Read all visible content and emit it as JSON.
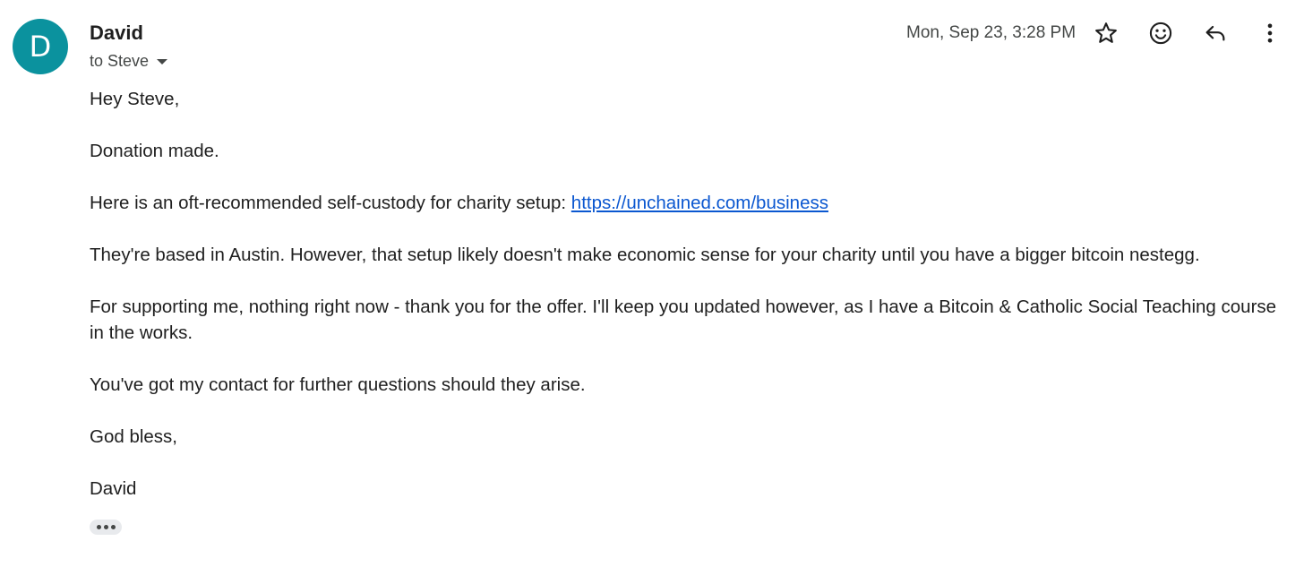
{
  "sender": {
    "avatar_letter": "D",
    "avatar_color": "#0b929e",
    "name": "David",
    "recipient_label": "to Steve"
  },
  "meta": {
    "timestamp": "Mon, Sep 23, 3:28 PM"
  },
  "toolbar": {
    "icons": [
      "star-icon",
      "emoji-icon",
      "reply-icon",
      "more-vert-icon"
    ]
  },
  "message": {
    "greeting": "Hey Steve,",
    "p1": "Donation made.",
    "p2_text": "Here is an oft-recommended self-custody for charity setup: ",
    "p2_link": "https://unchained.com/business",
    "p3": "They're based in Austin. However, that setup likely doesn't make economic sense for your charity until you have a bigger bitcoin nestegg.",
    "p4": "For supporting me, nothing right now - thank you for the offer. I'll keep you updated however, as I have a Bitcoin & Catholic Social Teaching course in the works.",
    "p5": "You've got my contact for further questions should they arise.",
    "closing": "God bless,",
    "signature": "David"
  },
  "colors": {
    "link": "#0b57d0",
    "text": "#1f1f1f",
    "secondary_text": "#444746"
  }
}
